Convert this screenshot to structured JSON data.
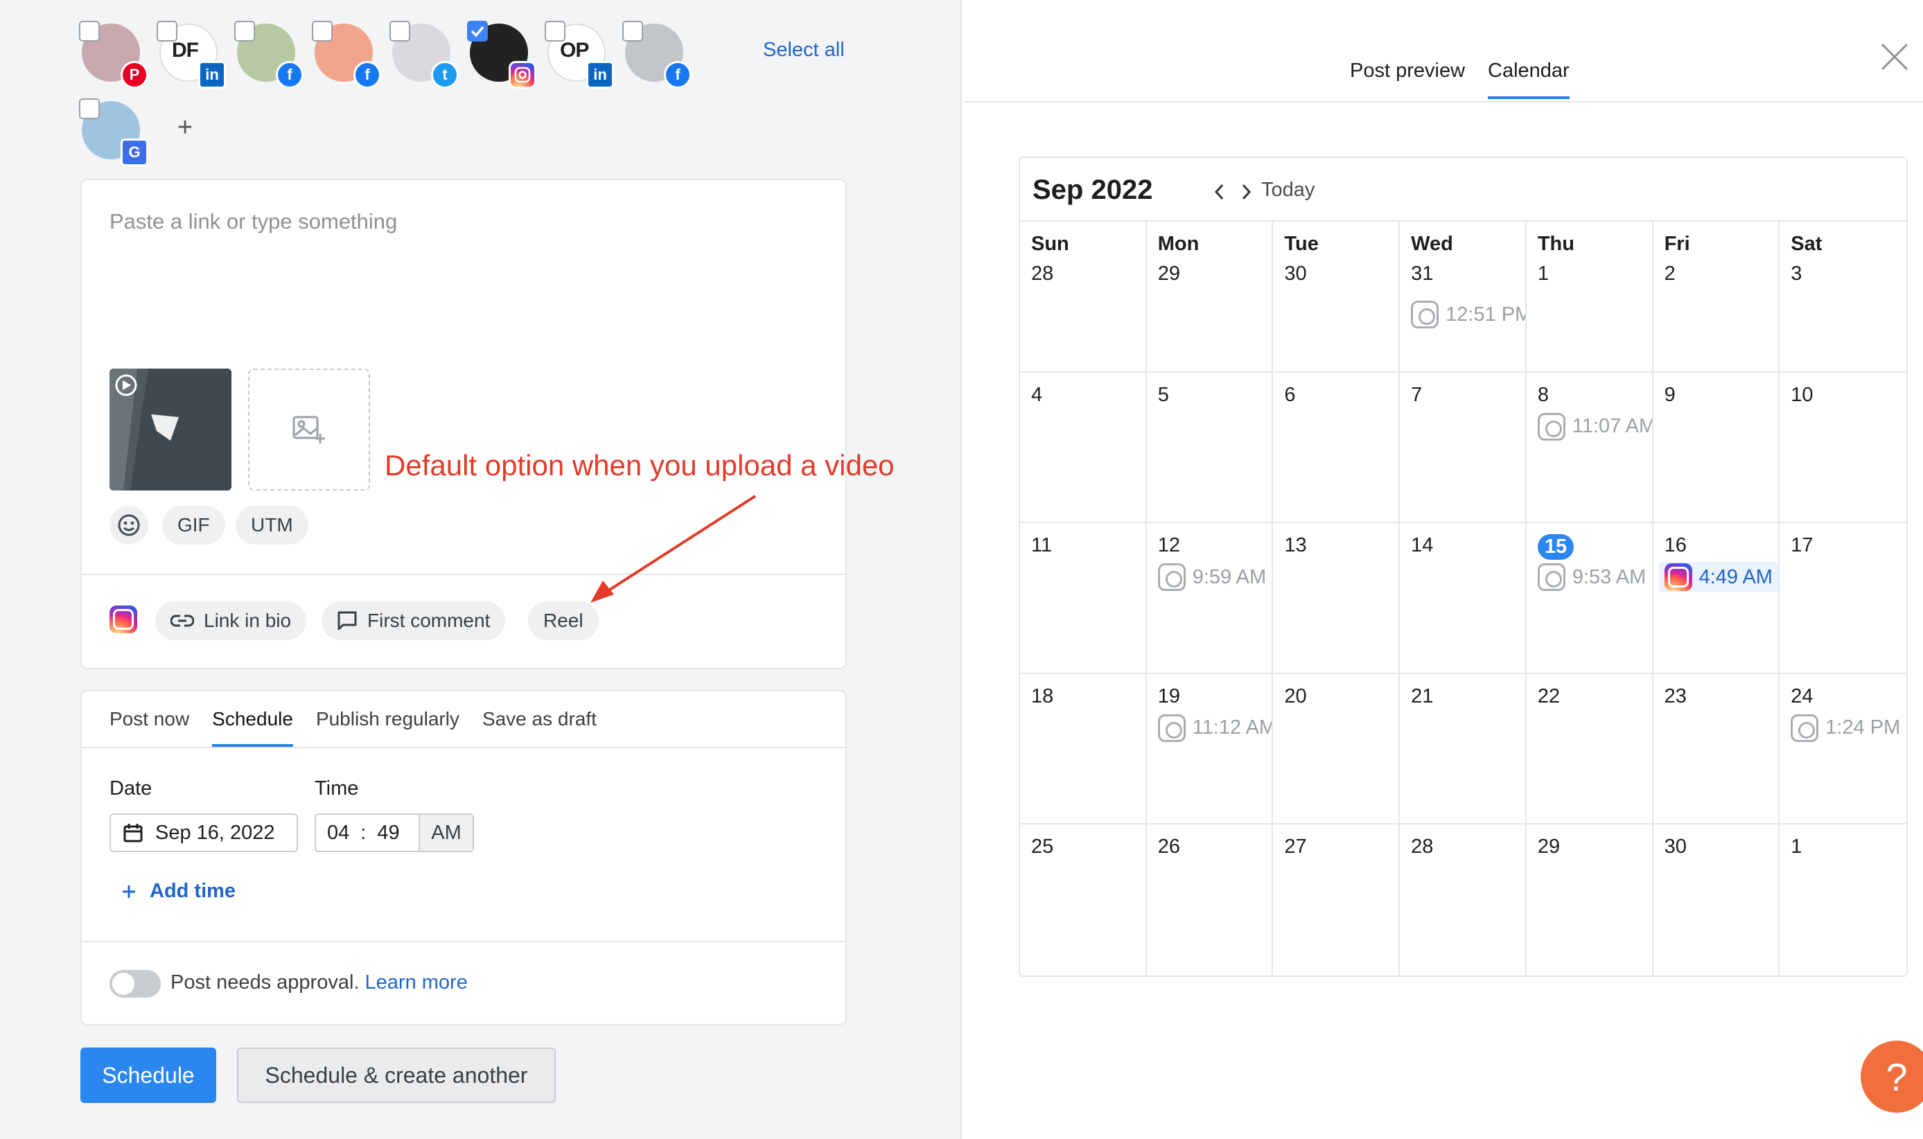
{
  "accounts": {
    "items": [
      {
        "initials": "",
        "network": "pinterest-icon",
        "checked": false
      },
      {
        "initials": "DF",
        "network": "linkedin-icon",
        "checked": false
      },
      {
        "initials": "",
        "network": "facebook-icon",
        "checked": false
      },
      {
        "initials": "",
        "network": "facebook-icon",
        "checked": false
      },
      {
        "initials": "",
        "network": "twitter-icon",
        "checked": false
      },
      {
        "initials": "",
        "network": "instagram-icon",
        "checked": true
      },
      {
        "initials": "OP",
        "network": "linkedin-icon",
        "checked": false
      },
      {
        "initials": "",
        "network": "facebook-icon",
        "checked": false
      },
      {
        "initials": "",
        "network": "google-business-icon",
        "checked": false
      }
    ],
    "select_all": "Select all",
    "add": "+"
  },
  "composer": {
    "placeholder": "Paste a link or type something",
    "tools": {
      "emoji": "emoji-icon",
      "gif": "GIF",
      "utm": "UTM"
    },
    "instagram_options": {
      "link_in_bio": "Link in bio",
      "first_comment": "First comment",
      "reel": "Reel"
    }
  },
  "annotation": "Default option when you upload a video",
  "schedule": {
    "tabs": [
      "Post now",
      "Schedule",
      "Publish regularly",
      "Save as draft"
    ],
    "active_tab": "Schedule",
    "date_label": "Date",
    "time_label": "Time",
    "date_value": "Sep 16, 2022",
    "hour": "04",
    "minute": "49",
    "time_sep": ":",
    "ampm": "AM",
    "add_time": "Add time",
    "approval_text": "Post needs approval.",
    "learn_more": "Learn more"
  },
  "buttons": {
    "schedule": "Schedule",
    "schedule_another": "Schedule & create another"
  },
  "right_pane": {
    "tabs": [
      "Post preview",
      "Calendar"
    ],
    "active_tab": "Calendar"
  },
  "calendar": {
    "month": "Sep 2022",
    "today": "Today",
    "weekdays": [
      "Sun",
      "Mon",
      "Tue",
      "Wed",
      "Thu",
      "Fri",
      "Sat"
    ],
    "weeks": [
      [
        {
          "d": "28"
        },
        {
          "d": "29"
        },
        {
          "d": "30"
        },
        {
          "d": "31",
          "evt": "12:51 PM"
        },
        {
          "d": "1"
        },
        {
          "d": "2"
        },
        {
          "d": "3"
        }
      ],
      [
        {
          "d": "4"
        },
        {
          "d": "5"
        },
        {
          "d": "6"
        },
        {
          "d": "7"
        },
        {
          "d": "8",
          "evt": "11:07 AM"
        },
        {
          "d": "9"
        },
        {
          "d": "10"
        }
      ],
      [
        {
          "d": "11"
        },
        {
          "d": "12",
          "evt": "9:59 AM"
        },
        {
          "d": "13"
        },
        {
          "d": "14"
        },
        {
          "d": "15",
          "today": true,
          "evt": "9:53 AM"
        },
        {
          "d": "16",
          "evt": "4:49 AM",
          "active": true
        },
        {
          "d": "17"
        }
      ],
      [
        {
          "d": "18"
        },
        {
          "d": "19",
          "evt": "11:12 AM"
        },
        {
          "d": "20"
        },
        {
          "d": "21"
        },
        {
          "d": "22"
        },
        {
          "d": "23"
        },
        {
          "d": "24",
          "evt": "1:24 PM"
        }
      ],
      [
        {
          "d": "25"
        },
        {
          "d": "26"
        },
        {
          "d": "27"
        },
        {
          "d": "28"
        },
        {
          "d": "29"
        },
        {
          "d": "30"
        },
        {
          "d": "1"
        }
      ]
    ]
  },
  "help": "?"
}
